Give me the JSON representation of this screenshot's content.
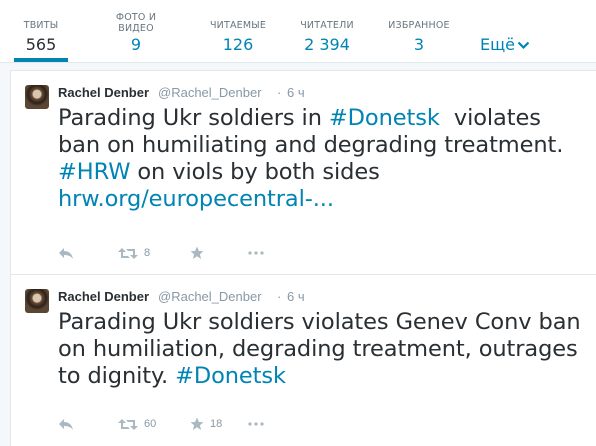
{
  "nav": {
    "stats": [
      {
        "label": "ТВИТЫ",
        "value": "565"
      },
      {
        "label": "ФОТО И ВИДЕО",
        "value": "9"
      },
      {
        "label": "ЧИТАЕМЫЕ",
        "value": "126"
      },
      {
        "label": "ЧИТАТЕЛИ",
        "value": "2 394"
      },
      {
        "label": "ИЗБРАННОЕ",
        "value": "3"
      }
    ],
    "more_label": "Ещё"
  },
  "tweets": [
    {
      "fullname": "Rachel Denber",
      "username": "@Rachel_Denber",
      "separator": "·",
      "time": "6 ч",
      "text_1": "Parading Ukr soldiers in ",
      "hashtag_1": "#Donetsk",
      "text_2": "  violates ban on humiliating and degrading treatment. ",
      "hashtag_2": "#HRW",
      "text_3": " on viols by both sides ",
      "link": "hrw.org/europecentral-...",
      "retweet_count": "8",
      "favorite_count": ""
    },
    {
      "fullname": "Rachel Denber",
      "username": "@Rachel_Denber",
      "separator": "·",
      "time": "6 ч",
      "text_1": "Parading Ukr soldiers violates Genev Conv ban on humiliation, degrading treatment, outrages to dignity. ",
      "hashtag_1": "#Donetsk",
      "retweet_count": "60",
      "favorite_count": "18"
    }
  ],
  "colors": {
    "link": "#0084b4",
    "text": "#292f33",
    "muted": "#8899a6",
    "active_underline": "#0084b4"
  }
}
